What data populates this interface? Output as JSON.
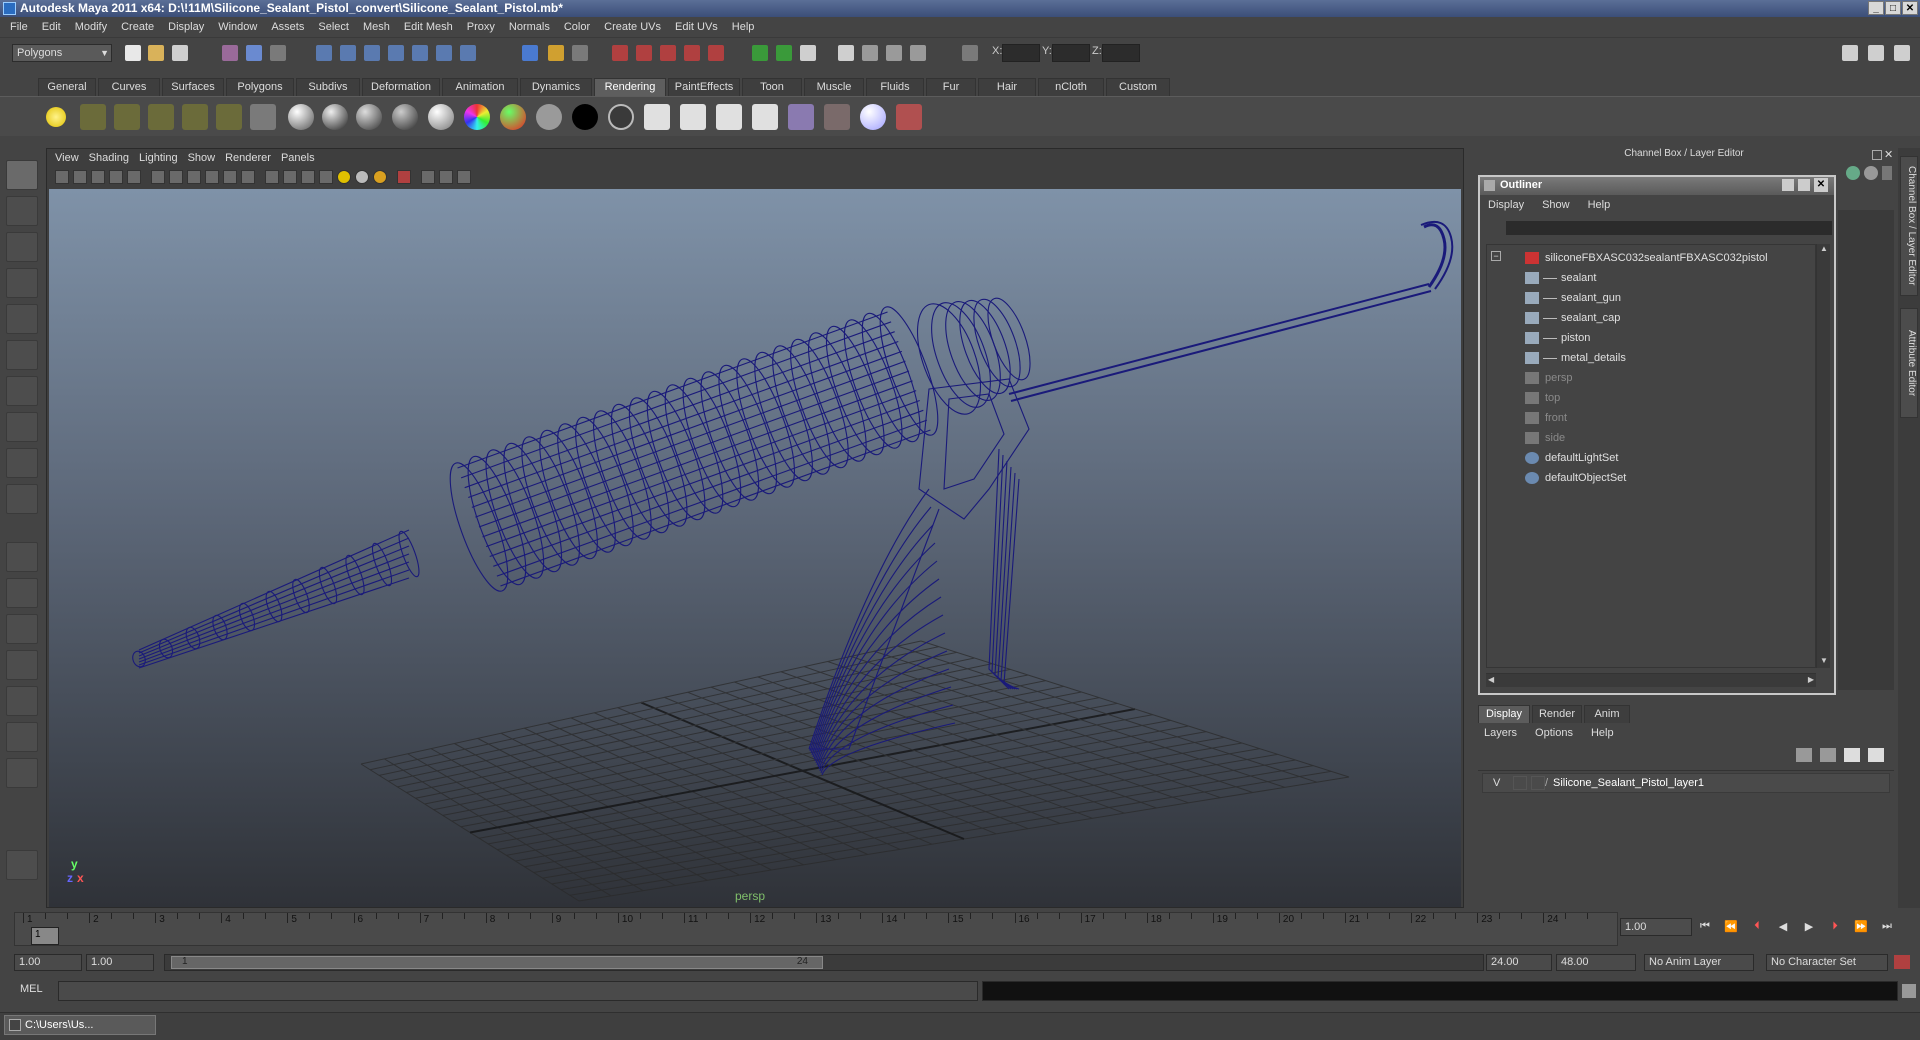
{
  "window": {
    "title": "Autodesk Maya 2011 x64: D:\\!11M\\Silicone_Sealant_Pistol_convert\\Silicone_Sealant_Pistol.mb*"
  },
  "menubar": [
    "File",
    "Edit",
    "Modify",
    "Create",
    "Display",
    "Window",
    "Assets",
    "Select",
    "Mesh",
    "Edit Mesh",
    "Proxy",
    "Normals",
    "Color",
    "Create UVs",
    "Edit UVs",
    "Help"
  ],
  "statusline": {
    "mode": "Polygons",
    "x_label": "X:",
    "y_label": "Y:",
    "z_label": "Z:"
  },
  "shelf": {
    "tabs": [
      "General",
      "Curves",
      "Surfaces",
      "Polygons",
      "Subdivs",
      "Deformation",
      "Animation",
      "Dynamics",
      "Rendering",
      "PaintEffects",
      "Toon",
      "Muscle",
      "Fluids",
      "Fur",
      "Hair",
      "nCloth",
      "Custom"
    ],
    "active_tab": "Rendering"
  },
  "viewport": {
    "menu": [
      "View",
      "Shading",
      "Lighting",
      "Show",
      "Renderer",
      "Panels"
    ],
    "camera": "persp",
    "axis_y": "y",
    "axis_x": "x",
    "axis_z": "z",
    "wire_color": "#1a1a7a"
  },
  "dock": {
    "header": "Channel Box / Layer Editor",
    "side_tabs": [
      "Channel Box / Layer Editor",
      "Attribute Editor"
    ]
  },
  "outliner": {
    "title": "Outliner",
    "menu": [
      "Display",
      "Show",
      "Help"
    ],
    "items": [
      {
        "label": "siliconeFBXASC032sealantFBXASC032pistol",
        "level": 0,
        "dim": false,
        "icon": "transform-icon"
      },
      {
        "label": "sealant",
        "level": 1,
        "dim": false,
        "icon": "mesh-icon"
      },
      {
        "label": "sealant_gun",
        "level": 1,
        "dim": false,
        "icon": "mesh-icon"
      },
      {
        "label": "sealant_cap",
        "level": 1,
        "dim": false,
        "icon": "mesh-icon"
      },
      {
        "label": "piston",
        "level": 1,
        "dim": false,
        "icon": "mesh-icon"
      },
      {
        "label": "metal_details",
        "level": 1,
        "dim": false,
        "icon": "mesh-icon"
      },
      {
        "label": "persp",
        "level": 0,
        "dim": true,
        "icon": "camera-icon"
      },
      {
        "label": "top",
        "level": 0,
        "dim": true,
        "icon": "camera-icon"
      },
      {
        "label": "front",
        "level": 0,
        "dim": true,
        "icon": "camera-icon"
      },
      {
        "label": "side",
        "level": 0,
        "dim": true,
        "icon": "camera-icon"
      },
      {
        "label": "defaultLightSet",
        "level": 0,
        "dim": false,
        "icon": "set-icon"
      },
      {
        "label": "defaultObjectSet",
        "level": 0,
        "dim": false,
        "icon": "set-icon"
      }
    ]
  },
  "layer_editor": {
    "tabs": [
      "Display",
      "Render",
      "Anim"
    ],
    "active_tab": "Display",
    "menu": [
      "Layers",
      "Options",
      "Help"
    ],
    "layers": [
      {
        "visible": "V",
        "name": "Silicone_Sealant_Pistol_layer1"
      }
    ]
  },
  "timeline": {
    "ticks": [
      "1",
      "2",
      "3",
      "4",
      "5",
      "6",
      "7",
      "8",
      "9",
      "10",
      "11",
      "12",
      "13",
      "14",
      "15",
      "16",
      "17",
      "18",
      "19",
      "20",
      "21",
      "22",
      "23",
      "24"
    ],
    "current_frame": "1.00",
    "current_marker": "1"
  },
  "range": {
    "start": "1.00",
    "playback_start": "1.00",
    "bar_start": "1",
    "bar_end": "24",
    "playback_end": "24.00",
    "end": "48.00",
    "anim_layer": "No Anim Layer",
    "character_set": "No Character Set"
  },
  "commandline": {
    "label": "MEL"
  },
  "taskbar": {
    "item": "C:\\Users\\Us..."
  }
}
